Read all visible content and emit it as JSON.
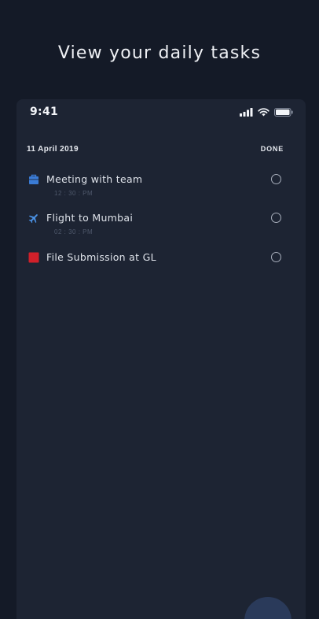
{
  "header": {
    "title": "View your daily tasks"
  },
  "status_bar": {
    "time": "9:41",
    "icons": [
      "cellular-signal-icon",
      "wifi-icon",
      "battery-icon"
    ]
  },
  "task_list": {
    "date": "11 April 2019",
    "done_label": "DONE",
    "tasks": [
      {
        "title": "Meeting with team",
        "time": "12 : 30 : PM",
        "icon": "briefcase-icon",
        "icon_color": "#3a7bd5"
      },
      {
        "title": "Flight to Mumbai",
        "time": "02 : 30 : PM",
        "icon": "airplane-icon",
        "icon_color": "#4a90e2"
      },
      {
        "title": "File Submission at GL",
        "time": "",
        "icon": "file-icon",
        "icon_color": "#d0202a"
      }
    ]
  },
  "colors": {
    "background": "#141a27",
    "card": "#1d2433",
    "text": "#e6e9ef",
    "muted_text": "#4e586b"
  }
}
